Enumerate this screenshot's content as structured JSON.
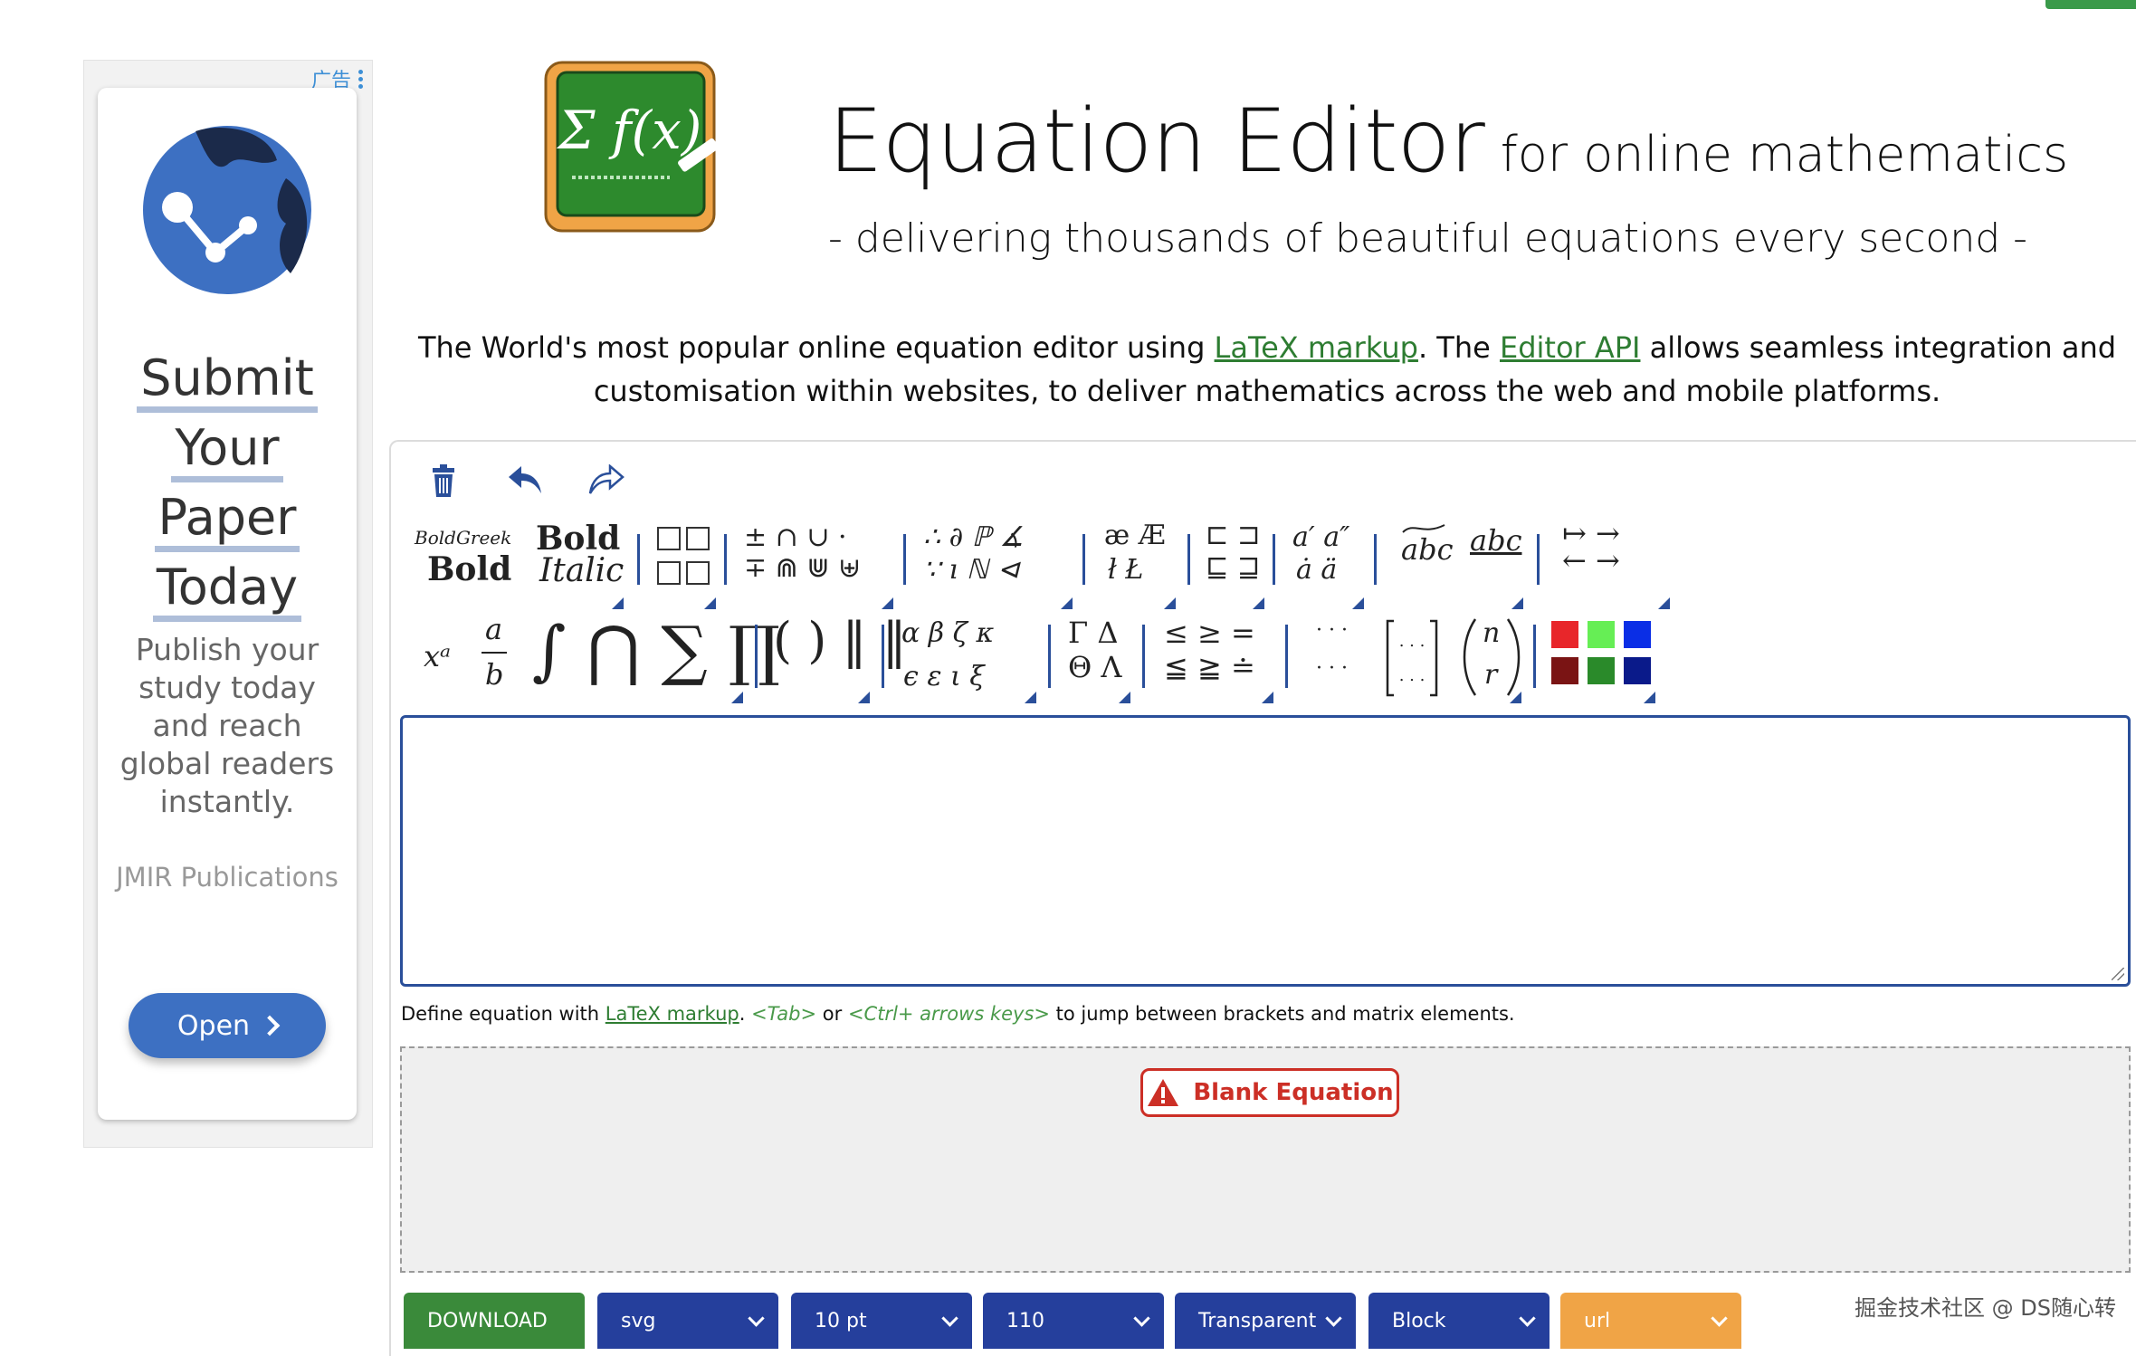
{
  "ad": {
    "tag": "广告",
    "headline": [
      "Submit",
      "Your",
      "Paper",
      "Today"
    ],
    "body": "Publish your study today and reach global readers instantly.",
    "brand": "JMIR Publications",
    "cta": "Open"
  },
  "header": {
    "logo_text": "Σ f(x)",
    "title": "Equation Editor",
    "subtitle": "for online mathematics",
    "tagline": "- delivering thousands of beautiful equations every second -"
  },
  "intro": {
    "text1": "The World's most popular online equation editor using ",
    "link1": "LaTeX markup",
    "text2": ". The ",
    "link2": "Editor API",
    "text3": " allows seamless integration and customisation within websites, to deliver mathematics across the web and mobile platforms."
  },
  "toolbar": {
    "bold_greek": "BoldGreek",
    "bold": "Bold",
    "bold2": "Bold",
    "italic": "Italic",
    "ops_top": "±  ∩  ∪  ·",
    "ops_bottom": "∓  ⋒  ⋓  ⊎",
    "logic_top": "∴  ∂  ℙ  ∡",
    "logic_bottom": "∵  ı  ℕ  ⊲",
    "lig_top": "æ  Æ",
    "lig_bottom": "ł  Ł",
    "set_top": "⊏  ⊐",
    "set_bottom": "⊑  ⊒",
    "prime_top": "a′  a″",
    "prime_bottom": "ȧ  ä",
    "abc_wide": "abc",
    "abc_over": "abc",
    "arrows_top": "↦  →",
    "arrows_bottom": "←  →",
    "power": "xᵃ",
    "frac_num": "a",
    "frac_den": "b",
    "big_ops": "∫ ⋂ ∑ ∏",
    "brackets": "( ) ‖ ‖",
    "greek_top": "α  β  ζ  κ",
    "greek_bottom": "ϵ  ε  ι  ξ",
    "ugreek_top": "Γ  Δ",
    "ugreek_bottom": "Θ  Λ",
    "rel_top": "≤  ≥  =",
    "rel_bottom": "≦  ≧  ≐",
    "dots_top": "· · ·",
    "dots_bottom": "· · ·",
    "matrix": "[ ⋯ ]",
    "binom_n": "n",
    "binom_r": "r"
  },
  "colors": {
    "swatches_top": [
      "#e8262a",
      "#66ee55",
      "#0a2ee6"
    ],
    "swatches_bottom": [
      "#7a1414",
      "#2a8a2a",
      "#0a1a8a"
    ],
    "accent_green": "#3a8a3a",
    "accent_blue": "#253f9c",
    "accent_orange": "#f0a446"
  },
  "editor": {
    "value": "",
    "hint_pre": "Define equation with ",
    "hint_link": "LaTeX markup",
    "hint_mid1": ". ",
    "hint_tab": "<Tab>",
    "hint_or": " or ",
    "hint_ctrl": "<Ctrl+ arrows keys>",
    "hint_post": " to jump between brackets and matrix elements."
  },
  "preview": {
    "status": "Blank Equation"
  },
  "controls": {
    "download": "DOWNLOAD",
    "format": "svg",
    "size": "10 pt",
    "dpi": "110",
    "background": "Transparent",
    "display": "Block",
    "output": "url"
  },
  "watermark": "掘金技术社区 @ DS随心转"
}
